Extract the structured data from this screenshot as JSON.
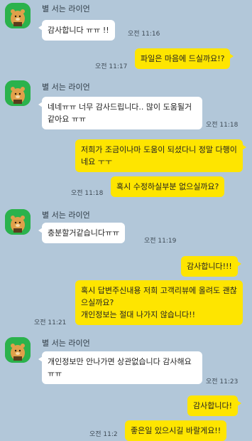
{
  "sender_name": "별 서는 라이언",
  "messages": [
    {
      "dir": "in",
      "text": "감사합니다 ㅠㅠ !!",
      "time": "오전 11:16"
    },
    {
      "dir": "out",
      "text": "파일은 마음에 드실까요!?",
      "time": "오전 11:17"
    },
    {
      "dir": "in",
      "text": "네네ㅠㅠ 너무 감사드립니다.. 많이 도움될거같아요 ㅠㅠ",
      "time": "오전 11:18"
    },
    {
      "dir": "out",
      "text": "저희가 조금이나마 도움이 되셨다니 정말 다행이네요 ㅜㅜ",
      "time": ""
    },
    {
      "dir": "out",
      "text": "혹시 수정하실부분 없으실까요?",
      "time": "오전 11:18"
    },
    {
      "dir": "in",
      "text": "충분할거같습니다ㅠㅠ",
      "time": "오전 11:19"
    },
    {
      "dir": "out",
      "text": "감사합니다!!!",
      "time": ""
    },
    {
      "dir": "out",
      "text": "혹시 답변주신내용 저희 고객리뷰에 올려도 괜찮으실까요?\n개인정보는 절대 나가지 않습니다!!",
      "time": "오전 11:21"
    },
    {
      "dir": "in",
      "text": "개인정보만 안나가면 상관없습니다 감사해요 ㅠㅠ",
      "time": "오전 11:23"
    },
    {
      "dir": "out",
      "text": "감사합니다!",
      "time": ""
    },
    {
      "dir": "out",
      "text": "좋은일 있으시길 바랄게요!!",
      "time": "오전 11:2"
    }
  ]
}
